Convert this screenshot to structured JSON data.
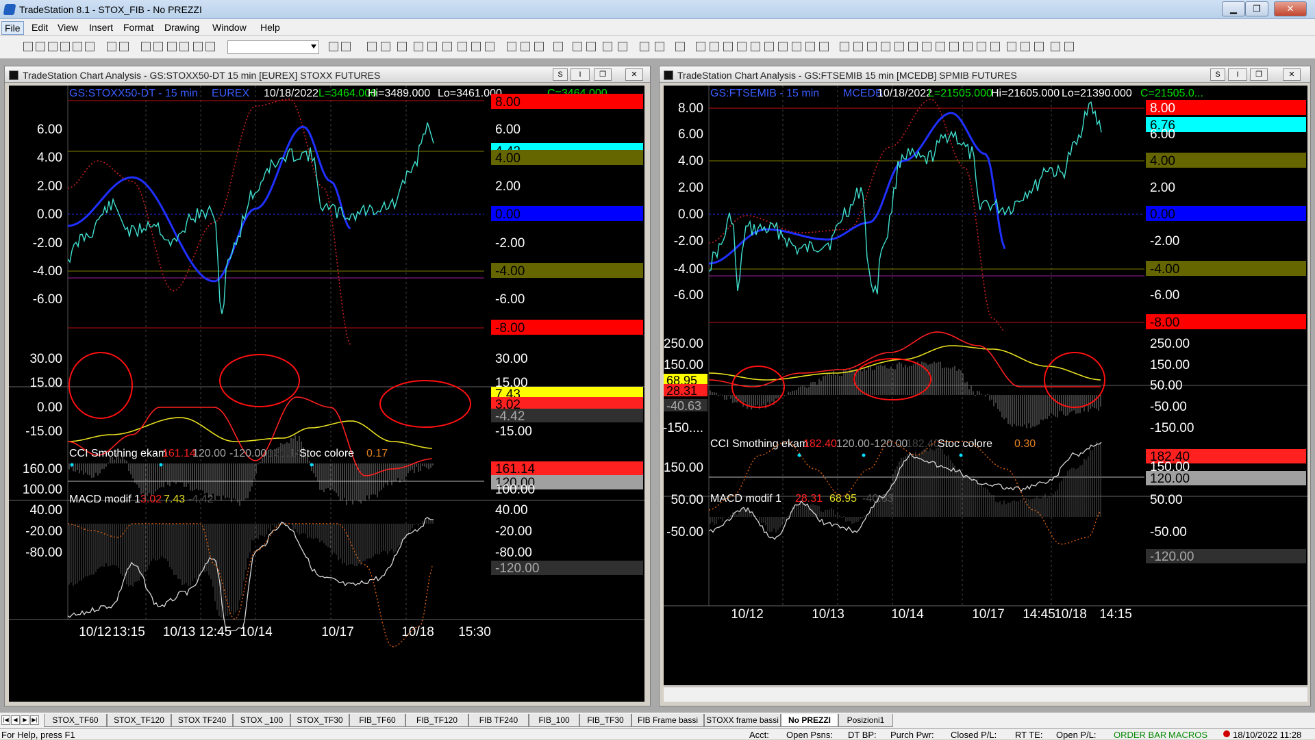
{
  "app": {
    "title": "TradeStation 8.1 - STOX_FIB - No PREZZI",
    "minimize": "▁",
    "restore": "❐",
    "close": "✕"
  },
  "menu": [
    "File",
    "Edit",
    "View",
    "Insert",
    "Format",
    "Drawing",
    "Window",
    "Help"
  ],
  "toolbar": {
    "symbol_combo": ""
  },
  "charts": [
    {
      "caption": "TradeStation Chart Analysis - GS:STOXX50-DT  15 min  [EUREX] STOXX FUTURES",
      "header": {
        "symbol": "GS:STOXX50-DT - 15 min",
        "exchange": "EUREX",
        "date": "10/18/2022",
        "last": "L=3464.000",
        "hi": "Hi=3489.000",
        "lo": "Lo=3461.000",
        "close": "C=3464.000"
      },
      "price_axis": [
        "6.00",
        "4.00",
        "2.00",
        "0.00",
        "-2.00",
        "-4.00",
        "-6.00"
      ],
      "price_axis_labels": [
        {
          "text": "8.00",
          "color": "#ff0000",
          "fg": "#000"
        },
        {
          "text": "6.00",
          "color": "",
          "fg": "#fff"
        },
        {
          "text": "4.42",
          "color": "#00ffff",
          "fg": "#000"
        },
        {
          "text": "4.00",
          "color": "#666600",
          "fg": "#000"
        },
        {
          "text": "2.00",
          "color": "",
          "fg": "#fff"
        },
        {
          "text": "0.00",
          "color": "#0000ff",
          "fg": "#000"
        },
        {
          "text": "-2.00",
          "color": "",
          "fg": "#fff"
        },
        {
          "text": "-4.00",
          "color": "#666600",
          "fg": "#000"
        },
        {
          "text": "-6.00",
          "color": "",
          "fg": "#fff"
        },
        {
          "text": "-8.00",
          "color": "#ff0000",
          "fg": "#000"
        }
      ],
      "macd": {
        "name": "MACD modif 1",
        "v1": "3.02",
        "v2": "7.43",
        "v3": "-4.42",
        "axis": [
          "30.00",
          "15.00",
          "0.00",
          "-15.00"
        ],
        "right_axis": [
          "30.00",
          "15.00",
          "7.43",
          "3.02",
          "-4.42",
          "-15.00"
        ]
      },
      "cci": {
        "name": "CCI Smothing ekam",
        "v1": "161.14",
        "v2": "120.00",
        "v3": "-120.00",
        "v4": "161.14",
        "stoc_name": "Stoc colore",
        "stoc_value": "0.17",
        "axis": [
          "160.00",
          "100.00",
          "40.00",
          "-20.00",
          "-80.00"
        ],
        "right_axis": [
          "161.14",
          "120.00",
          "100.00",
          "40.00",
          "-20.00",
          "-80.00",
          "-120.00"
        ]
      },
      "time_axis": [
        "10/12",
        "13:15",
        "10/13 12:45",
        "10/14",
        "10/17",
        "10/18",
        "15:30"
      ]
    },
    {
      "caption": "TradeStation Chart Analysis - GS:FTSEMIB  15 min  [MCEDB] SPMIB FUTURES",
      "header": {
        "symbol": "GS:FTSEMIB - 15 min",
        "exchange": "MCEDB",
        "date": "10/18/2022",
        "last": "L=21505.000",
        "hi": "Hi=21605.000",
        "lo": "Lo=21390.000",
        "close": "C=21505.0..."
      },
      "price_axis": [
        "8.00",
        "6.00",
        "4.00",
        "2.00",
        "0.00",
        "-2.00",
        "-4.00",
        "-6.00"
      ],
      "price_axis_labels": [
        {
          "text": "8.00",
          "color": "#ff0000",
          "fg": "#fff"
        },
        {
          "text": "6.76",
          "color": "#00ffff",
          "fg": "#000"
        },
        {
          "text": "6.00",
          "color": "",
          "fg": "#fff"
        },
        {
          "text": "4.00",
          "color": "#666600",
          "fg": "#000"
        },
        {
          "text": "2.00",
          "color": "",
          "fg": "#fff"
        },
        {
          "text": "0.00",
          "color": "#0000ff",
          "fg": "#000"
        },
        {
          "text": "-2.00",
          "color": "",
          "fg": "#fff"
        },
        {
          "text": "-4.00",
          "color": "#666600",
          "fg": "#000"
        },
        {
          "text": "-6.00",
          "color": "",
          "fg": "#fff"
        },
        {
          "text": "-8.00",
          "color": "#ff0000",
          "fg": "#000"
        }
      ],
      "macd": {
        "name": "MACD modif 1",
        "v1": "28.31",
        "v2": "68.95",
        "v3": "-40.63",
        "axis": [
          "250.00",
          "150.00",
          "50.00",
          "-50.00",
          "-150...."
        ],
        "right_axis": [
          "250.00",
          "150.00",
          "50.00",
          "-50.00",
          "-150.00"
        ],
        "left_labels": [
          "68.95",
          "28.31",
          "-40.63"
        ]
      },
      "cci": {
        "name": "CCI Smothing ekam",
        "v1": "182.40",
        "v2": "120.00",
        "v3": "-120.00",
        "v4": "182.40",
        "stoc_name": "Stoc colore",
        "stoc_value": "0.30",
        "axis": [
          "150.00",
          "50.00",
          "-50.00"
        ],
        "right_axis": [
          "182.40",
          "150.00",
          "120.00",
          "50.00",
          "-50.00",
          "-120.00"
        ]
      },
      "time_axis": [
        "10/12",
        "10/13",
        "10/14",
        "10/17",
        "14:45",
        "10/18",
        "14:15"
      ]
    }
  ],
  "tabs": [
    "STOX_TF60",
    "STOX_TF120",
    "STOX TF240",
    "STOX _100",
    "STOX_TF30",
    "FIB_TF60",
    "FIB_TF120",
    "FIB TF240",
    "FIB_100",
    "FIB_TF30",
    "FIB Frame bassi",
    "STOXX frame bassi",
    "No PREZZI",
    "Posizioni1"
  ],
  "status": {
    "help": "For Help, press F1",
    "acct": "Acct:",
    "open_psns": "Open Psns:",
    "dt_bp": "DT BP:",
    "purch_pwr": "Purch Pwr:",
    "closed_pl": "Closed P/L:",
    "rt_te": "RT TE:",
    "open_pl": "Open P/L:",
    "order_bar": "ORDER BAR",
    "macros": "MACROS",
    "datetime": "18/10/2022 11:28"
  },
  "colors": {
    "price": "#40e0d0",
    "smooth": "#2030ff",
    "dotted": "#cc2020",
    "macd_signal": "#e8e020",
    "macd_line": "#ff2020",
    "hist": "#808080",
    "annot": "#ff1010"
  }
}
